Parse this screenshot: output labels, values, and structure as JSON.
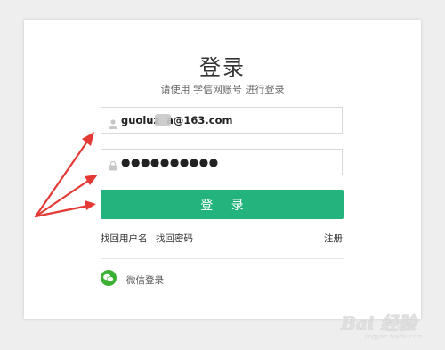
{
  "login": {
    "title": "登录",
    "subtitle": "请使用 学信网账号 进行登录",
    "username_value": "guoluz  a@163.com",
    "password_value": "●●●●●●●●●●",
    "submit_label": "登 录",
    "forgot_username": "找回用户名",
    "forgot_password": "找回密码",
    "register": "注册",
    "wechat_login": "微信登录"
  },
  "colors": {
    "primary_button": "#23b47e",
    "wechat_green": "#3cb034",
    "annotation_arrow": "#e53935"
  },
  "icons": [
    "user-icon",
    "lock-icon",
    "wechat-icon"
  ],
  "watermark": {
    "text": "Bai 经验",
    "url": "jingyan.baidu.com"
  }
}
